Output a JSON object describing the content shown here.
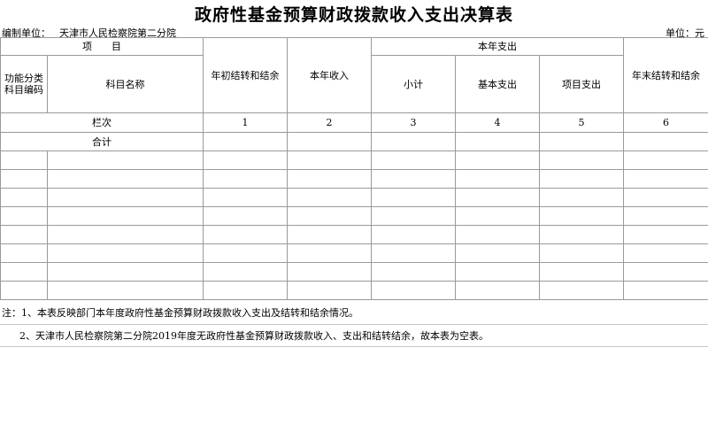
{
  "header": {
    "title": "政府性基金预算财政拨款收入支出决算表",
    "org_label": "编制单位：",
    "org_name": "天津市人民检察院第二分院",
    "unit": "单位：元"
  },
  "table": {
    "col_item": "项　　目",
    "col_func_code": "功能分类\n科目编码",
    "col_subject_name": "科目名称",
    "col_begin_balance": "年初结转和结余",
    "col_income": "本年收入",
    "col_expense_group": "本年支出",
    "col_subtotal": "小计",
    "col_basic": "基本支出",
    "col_project": "项目支出",
    "col_end_balance": "年末结转和结余",
    "row_index_label": "栏次",
    "row_index_values": [
      "1",
      "2",
      "3",
      "4",
      "5",
      "6"
    ],
    "row_total_label": "合计"
  },
  "notes": {
    "note1": "注：1、本表反映部门本年度政府性基金预算财政拨款收入支出及结转和结余情况。",
    "note2": "2、天津市人民检察院第二分院2019年度无政府性基金预算财政拨款收入、支出和结转结余，故本表为空表。"
  }
}
